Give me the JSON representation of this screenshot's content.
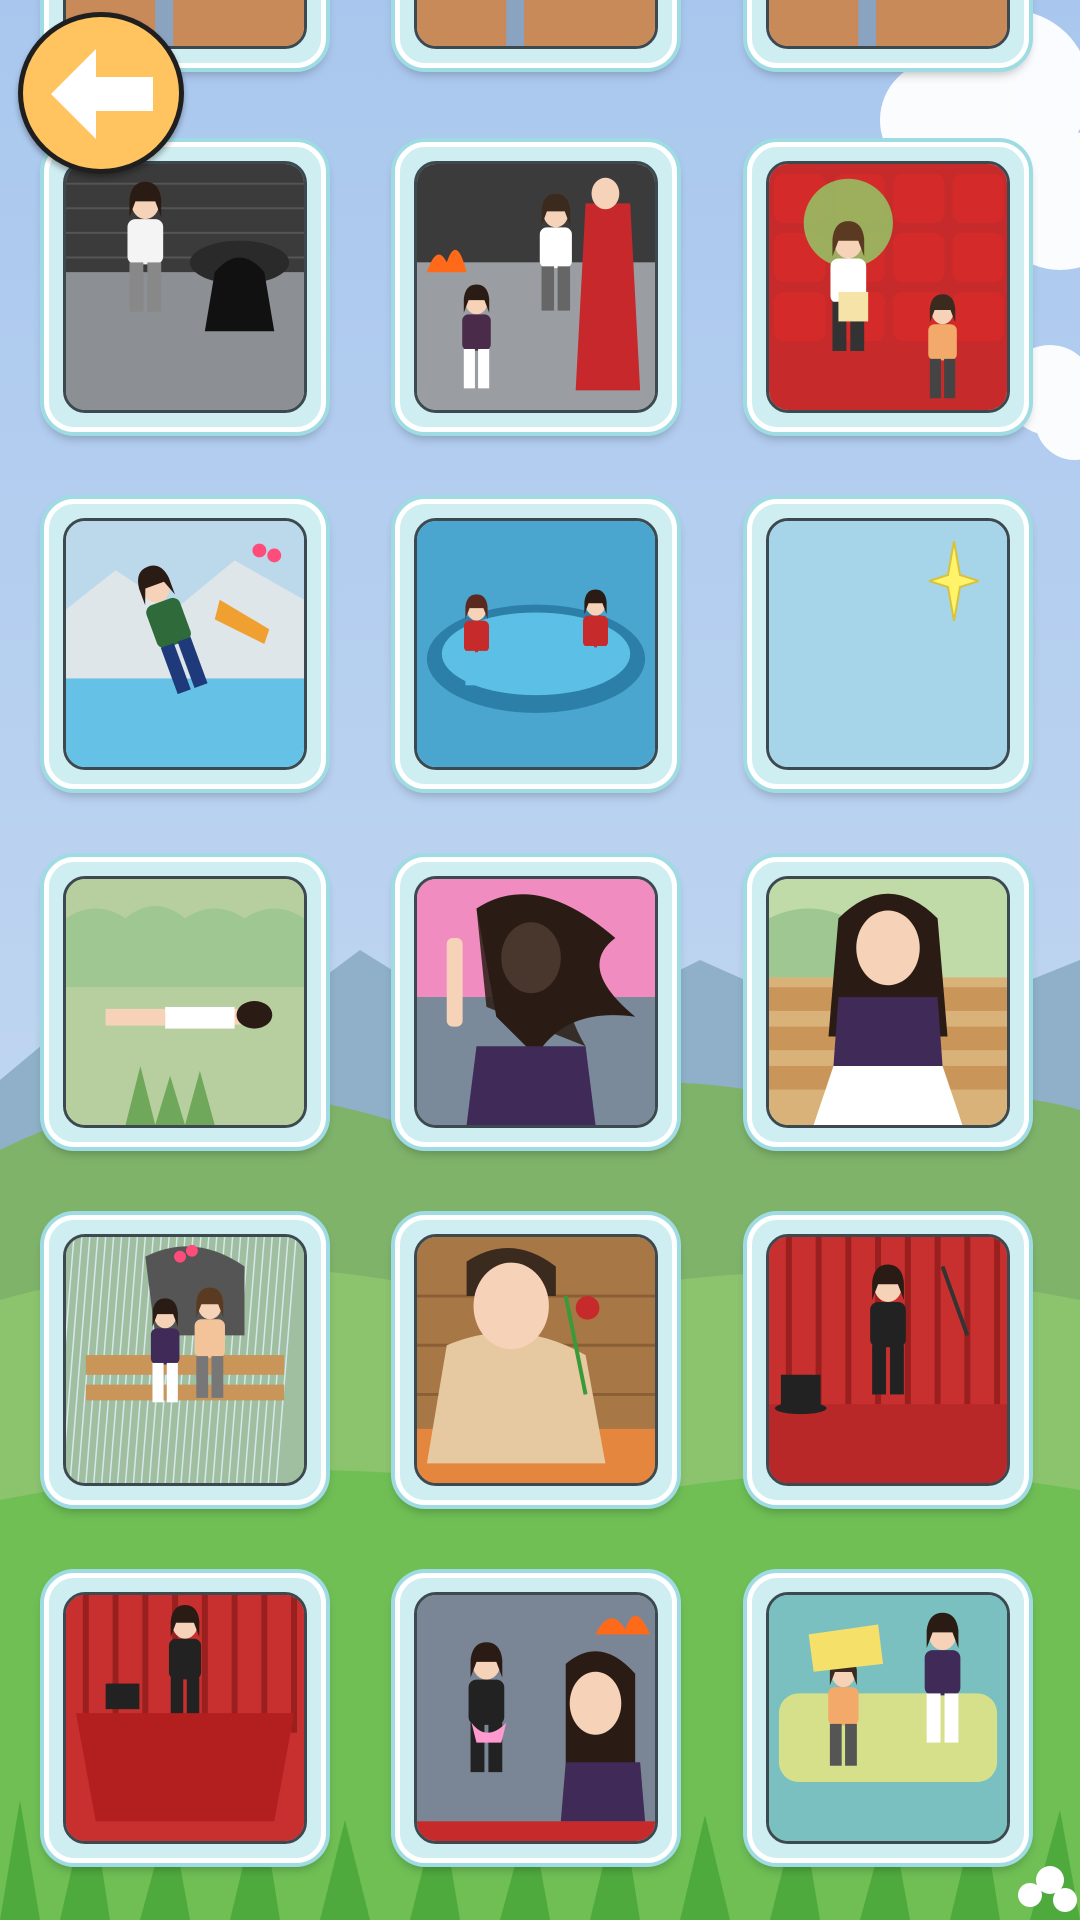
{
  "screen": {
    "name": "level-select",
    "columns": 3
  },
  "colors": {
    "sky_top": "#a9c7ee",
    "sky_bottom": "#c9dcf2",
    "hill": "#7fb36a",
    "grass": "#5fbf4a",
    "card_border": "#9fdbe3",
    "back_button": "#ffc460"
  },
  "back_button": {
    "icon": "arrow-left-icon"
  },
  "levels": [
    {
      "id": "level-1",
      "scene": "partial-top",
      "locked": false
    },
    {
      "id": "level-2",
      "scene": "partial-top",
      "locked": false
    },
    {
      "id": "level-3",
      "scene": "partial-top",
      "locked": false
    },
    {
      "id": "level-4",
      "scene": "ghost-well",
      "locked": false
    },
    {
      "id": "level-5",
      "scene": "fire-well-rescue",
      "locked": false
    },
    {
      "id": "level-6",
      "scene": "cinema-popcorn",
      "locked": false
    },
    {
      "id": "level-7",
      "scene": "ice-skating",
      "locked": false
    },
    {
      "id": "level-8",
      "scene": "hot-tub",
      "locked": false
    },
    {
      "id": "level-9",
      "scene": "empty-sparkle",
      "locked": true
    },
    {
      "id": "level-10",
      "scene": "park-faint",
      "locked": false
    },
    {
      "id": "level-11",
      "scene": "windy-hair",
      "locked": false
    },
    {
      "id": "level-12",
      "scene": "bench-sad",
      "locked": false
    },
    {
      "id": "level-13",
      "scene": "rain-umbrella",
      "locked": false
    },
    {
      "id": "level-14",
      "scene": "crying-rose",
      "locked": false
    },
    {
      "id": "level-15",
      "scene": "magician-stage",
      "locked": false
    },
    {
      "id": "level-16",
      "scene": "magician-table",
      "locked": false
    },
    {
      "id": "level-17",
      "scene": "gift-fire",
      "locked": false
    },
    {
      "id": "level-18",
      "scene": "pillow-fight",
      "locked": false
    }
  ]
}
